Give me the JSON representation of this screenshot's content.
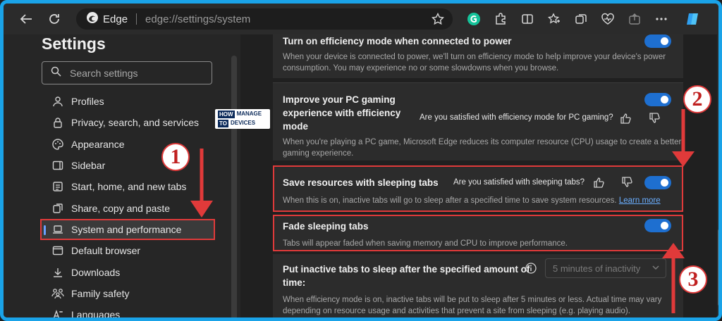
{
  "browser": {
    "brand": "Edge",
    "url": "edge://settings/system"
  },
  "settings": {
    "title": "Settings",
    "search_placeholder": "Search settings",
    "nav": [
      {
        "label": "Profiles",
        "icon": "profile-icon"
      },
      {
        "label": "Privacy, search, and services",
        "icon": "lock-icon"
      },
      {
        "label": "Appearance",
        "icon": "palette-icon"
      },
      {
        "label": "Sidebar",
        "icon": "sidebar-icon"
      },
      {
        "label": "Start, home, and new tabs",
        "icon": "home-icon"
      },
      {
        "label": "Share, copy and paste",
        "icon": "share-icon"
      },
      {
        "label": "System and performance",
        "icon": "laptop-icon",
        "active": true
      },
      {
        "label": "Default browser",
        "icon": "browser-icon"
      },
      {
        "label": "Downloads",
        "icon": "download-icon"
      },
      {
        "label": "Family safety",
        "icon": "family-icon"
      },
      {
        "label": "Languages",
        "icon": "language-icon"
      }
    ]
  },
  "content": {
    "power": {
      "title": "Turn on efficiency mode when connected to power",
      "desc1": "When your device is connected to power, we'll turn on efficiency mode to help improve your device's power",
      "desc2": "consumption. You may experience no or some slowdowns when you browse."
    },
    "gaming": {
      "title1": "Improve your PC gaming",
      "title2": "experience with efficiency",
      "title3": "mode",
      "feedback": "Are you satisfied with efficiency mode for PC gaming?",
      "desc1": "When you're playing a PC game, Microsoft Edge reduces its computer resource (CPU) usage to create a better",
      "desc2": "gaming experience."
    },
    "sleeping": {
      "title": "Save resources with sleeping tabs",
      "feedback": "Are you satisfied with sleeping tabs?",
      "desc": "When this is on, inactive tabs will go to sleep after a specified time to save system resources.",
      "learn_more": "Learn more"
    },
    "fade": {
      "title": "Fade sleeping tabs",
      "desc": "Tabs will appear faded when saving memory and CPU to improve performance."
    },
    "inactive": {
      "title1": "Put inactive tabs to sleep after the specified amount of",
      "title2": "time:",
      "dropdown": "5 minutes of inactivity",
      "desc1": "When efficiency mode is on, inactive tabs will be put to sleep after 5 minutes or less. Actual time may vary",
      "desc2": "depending on resource usage and activities that prevent a site from sleeping (e.g. playing audio)."
    }
  },
  "annotations": {
    "badge1": "1",
    "badge2": "2",
    "badge3": "3",
    "logo_line1": "HOW",
    "logo_line2": "MANAGE",
    "logo_line3": "TO",
    "logo_line4": "DEVICES"
  },
  "colors": {
    "accent": "#1e6fd0",
    "highlight": "#e03a3a",
    "frame": "#1aa3e8"
  }
}
